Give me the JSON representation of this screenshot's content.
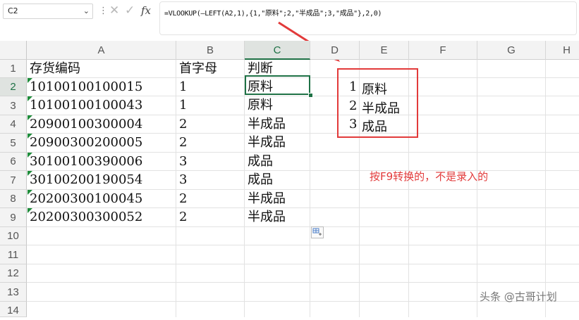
{
  "formula_bar": {
    "cell_ref": "C2",
    "formula": "=VLOOKUP(—LEFT(A2,1),{1,\"原料\";2,\"半成品\";3,\"成品\"},2,0)"
  },
  "columns": [
    "A",
    "B",
    "C",
    "D",
    "E",
    "F",
    "G",
    "H"
  ],
  "rows": [
    "1",
    "2",
    "3",
    "4",
    "5",
    "6",
    "7",
    "8",
    "9",
    "10",
    "11",
    "12",
    "13",
    "14"
  ],
  "table": {
    "headers": [
      "存货编码",
      "首字母",
      "判断"
    ],
    "data": [
      [
        "10100100100015",
        "1",
        "原料"
      ],
      [
        "10100100100043",
        "1",
        "原料"
      ],
      [
        "20900100300004",
        "2",
        "半成品"
      ],
      [
        "20900300200005",
        "2",
        "半成品"
      ],
      [
        "30100100390006",
        "3",
        "成品"
      ],
      [
        "30100200190054",
        "3",
        "成品"
      ],
      [
        "20200300100045",
        "2",
        "半成品"
      ],
      [
        "20200300300052",
        "2",
        "半成品"
      ]
    ]
  },
  "converted_array": [
    {
      "num": "1",
      "label": "原料"
    },
    {
      "num": "2",
      "label": "半成品"
    },
    {
      "num": "3",
      "label": "成品"
    }
  ],
  "annotation": "按F9转换的，不是录入的",
  "watermark": "头条 @古哥计划",
  "colors": {
    "accent": "#1e7145",
    "annotation": "#e23a3a",
    "text_triangle": "#1e8c3a"
  }
}
